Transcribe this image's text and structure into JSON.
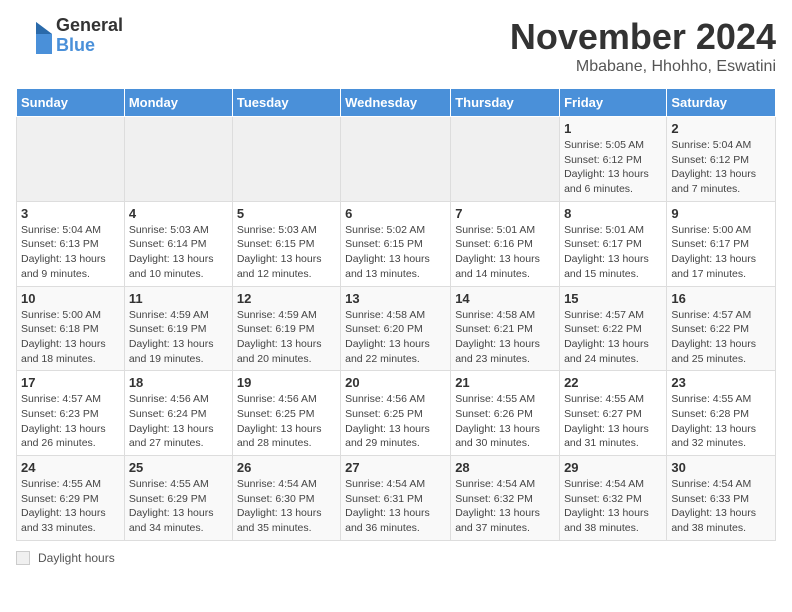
{
  "logo": {
    "general": "General",
    "blue": "Blue"
  },
  "title": "November 2024",
  "subtitle": "Mbabane, Hhohho, Eswatini",
  "calendar": {
    "headers": [
      "Sunday",
      "Monday",
      "Tuesday",
      "Wednesday",
      "Thursday",
      "Friday",
      "Saturday"
    ],
    "weeks": [
      [
        {
          "day": "",
          "info": ""
        },
        {
          "day": "",
          "info": ""
        },
        {
          "day": "",
          "info": ""
        },
        {
          "day": "",
          "info": ""
        },
        {
          "day": "",
          "info": ""
        },
        {
          "day": "1",
          "info": "Sunrise: 5:05 AM\nSunset: 6:12 PM\nDaylight: 13 hours and 6 minutes."
        },
        {
          "day": "2",
          "info": "Sunrise: 5:04 AM\nSunset: 6:12 PM\nDaylight: 13 hours and 7 minutes."
        }
      ],
      [
        {
          "day": "3",
          "info": "Sunrise: 5:04 AM\nSunset: 6:13 PM\nDaylight: 13 hours and 9 minutes."
        },
        {
          "day": "4",
          "info": "Sunrise: 5:03 AM\nSunset: 6:14 PM\nDaylight: 13 hours and 10 minutes."
        },
        {
          "day": "5",
          "info": "Sunrise: 5:03 AM\nSunset: 6:15 PM\nDaylight: 13 hours and 12 minutes."
        },
        {
          "day": "6",
          "info": "Sunrise: 5:02 AM\nSunset: 6:15 PM\nDaylight: 13 hours and 13 minutes."
        },
        {
          "day": "7",
          "info": "Sunrise: 5:01 AM\nSunset: 6:16 PM\nDaylight: 13 hours and 14 minutes."
        },
        {
          "day": "8",
          "info": "Sunrise: 5:01 AM\nSunset: 6:17 PM\nDaylight: 13 hours and 15 minutes."
        },
        {
          "day": "9",
          "info": "Sunrise: 5:00 AM\nSunset: 6:17 PM\nDaylight: 13 hours and 17 minutes."
        }
      ],
      [
        {
          "day": "10",
          "info": "Sunrise: 5:00 AM\nSunset: 6:18 PM\nDaylight: 13 hours and 18 minutes."
        },
        {
          "day": "11",
          "info": "Sunrise: 4:59 AM\nSunset: 6:19 PM\nDaylight: 13 hours and 19 minutes."
        },
        {
          "day": "12",
          "info": "Sunrise: 4:59 AM\nSunset: 6:19 PM\nDaylight: 13 hours and 20 minutes."
        },
        {
          "day": "13",
          "info": "Sunrise: 4:58 AM\nSunset: 6:20 PM\nDaylight: 13 hours and 22 minutes."
        },
        {
          "day": "14",
          "info": "Sunrise: 4:58 AM\nSunset: 6:21 PM\nDaylight: 13 hours and 23 minutes."
        },
        {
          "day": "15",
          "info": "Sunrise: 4:57 AM\nSunset: 6:22 PM\nDaylight: 13 hours and 24 minutes."
        },
        {
          "day": "16",
          "info": "Sunrise: 4:57 AM\nSunset: 6:22 PM\nDaylight: 13 hours and 25 minutes."
        }
      ],
      [
        {
          "day": "17",
          "info": "Sunrise: 4:57 AM\nSunset: 6:23 PM\nDaylight: 13 hours and 26 minutes."
        },
        {
          "day": "18",
          "info": "Sunrise: 4:56 AM\nSunset: 6:24 PM\nDaylight: 13 hours and 27 minutes."
        },
        {
          "day": "19",
          "info": "Sunrise: 4:56 AM\nSunset: 6:25 PM\nDaylight: 13 hours and 28 minutes."
        },
        {
          "day": "20",
          "info": "Sunrise: 4:56 AM\nSunset: 6:25 PM\nDaylight: 13 hours and 29 minutes."
        },
        {
          "day": "21",
          "info": "Sunrise: 4:55 AM\nSunset: 6:26 PM\nDaylight: 13 hours and 30 minutes."
        },
        {
          "day": "22",
          "info": "Sunrise: 4:55 AM\nSunset: 6:27 PM\nDaylight: 13 hours and 31 minutes."
        },
        {
          "day": "23",
          "info": "Sunrise: 4:55 AM\nSunset: 6:28 PM\nDaylight: 13 hours and 32 minutes."
        }
      ],
      [
        {
          "day": "24",
          "info": "Sunrise: 4:55 AM\nSunset: 6:29 PM\nDaylight: 13 hours and 33 minutes."
        },
        {
          "day": "25",
          "info": "Sunrise: 4:55 AM\nSunset: 6:29 PM\nDaylight: 13 hours and 34 minutes."
        },
        {
          "day": "26",
          "info": "Sunrise: 4:54 AM\nSunset: 6:30 PM\nDaylight: 13 hours and 35 minutes."
        },
        {
          "day": "27",
          "info": "Sunrise: 4:54 AM\nSunset: 6:31 PM\nDaylight: 13 hours and 36 minutes."
        },
        {
          "day": "28",
          "info": "Sunrise: 4:54 AM\nSunset: 6:32 PM\nDaylight: 13 hours and 37 minutes."
        },
        {
          "day": "29",
          "info": "Sunrise: 4:54 AM\nSunset: 6:32 PM\nDaylight: 13 hours and 38 minutes."
        },
        {
          "day": "30",
          "info": "Sunrise: 4:54 AM\nSunset: 6:33 PM\nDaylight: 13 hours and 38 minutes."
        }
      ]
    ]
  },
  "legend": {
    "box_label": "Daylight hours"
  }
}
